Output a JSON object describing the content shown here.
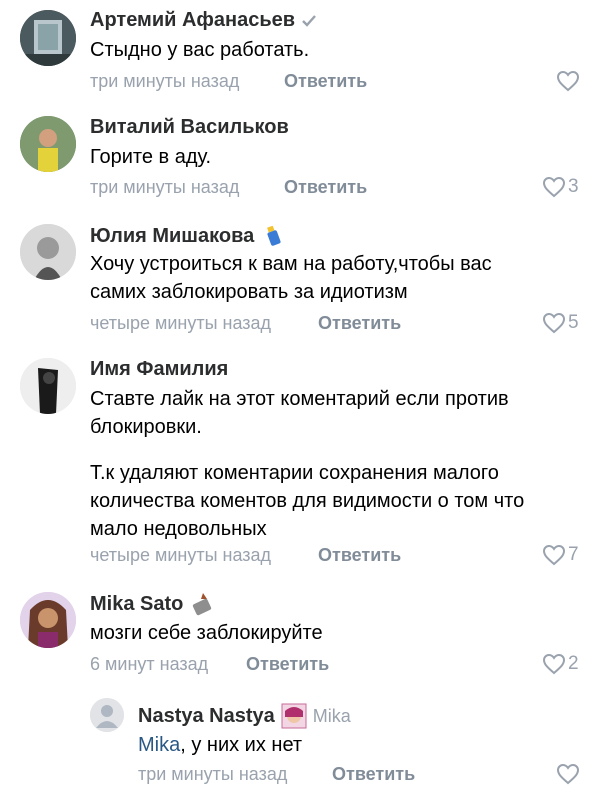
{
  "reply_label": "Ответить",
  "comments": [
    {
      "name": "Артемий Афанасьев",
      "lines": [
        "Стыдно у вас работать."
      ],
      "time": "три минуты назад",
      "likes": ""
    },
    {
      "name": "Виталий Васильков",
      "lines": [
        "Горите в аду."
      ],
      "time": "три минуты назад",
      "likes": "3"
    },
    {
      "name": "Юлия Мишакова",
      "lines": [
        "Хочу устроиться к вам на работу,чтобы вас",
        "самих заблокировать за идиотизм"
      ],
      "time": "четыре минуты назад",
      "likes": "5"
    },
    {
      "name": "Имя Фамилия",
      "lines": [
        "Ставте лайк на этот коментарий если против",
        "блокировки.",
        "",
        "Т.к удаляют коментарии  сохранения малого",
        "количества коментов для видимости о том что",
        "мало недовольных"
      ],
      "time": "четыре минуты назад",
      "likes": "7"
    },
    {
      "name": "Mika Sato",
      "lines": [
        "мозги себе заблокируйте"
      ],
      "time": "6 минут назад",
      "likes": "2"
    }
  ],
  "reply": {
    "name": "Nastya Nastya",
    "reply_to": "Mika",
    "mention": "Mika",
    "text_rest": ", у них их нет",
    "time": "три минуты назад",
    "likes": ""
  },
  "colors": {
    "name": "#2c2d2e",
    "meta": "#99a2ad",
    "reply": "#818c99",
    "mention": "#2a5885"
  }
}
